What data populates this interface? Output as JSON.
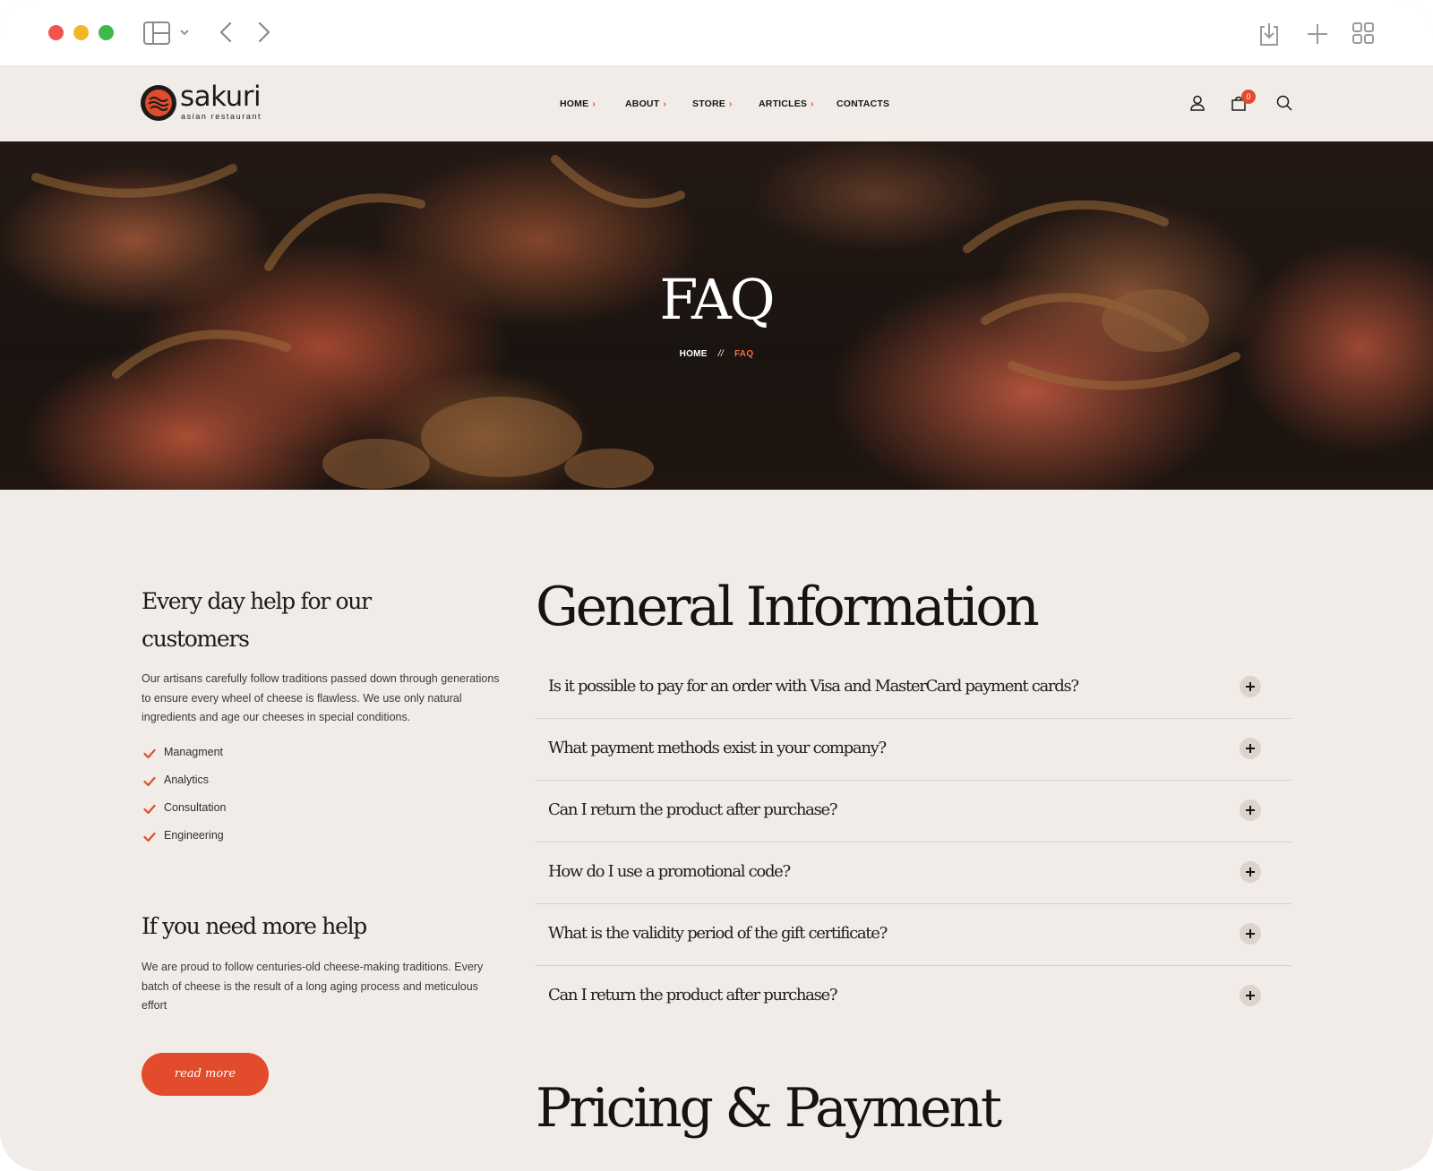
{
  "header": {
    "logo_name": "sakuri",
    "logo_tagline": "asian restaurant",
    "nav": [
      {
        "label": "HOME",
        "caret": "›"
      },
      {
        "label": "ABOUT",
        "caret": "›"
      },
      {
        "label": "STORE",
        "caret": "›"
      },
      {
        "label": "ARTICLES",
        "caret": "›"
      },
      {
        "label": "CONTACTS",
        "caret": ""
      }
    ],
    "cart_count": "0",
    "icons": [
      "user-icon",
      "cart-icon",
      "search-icon"
    ]
  },
  "hero": {
    "title": "FAQ",
    "breadcrumb": {
      "home": "HOME",
      "separator": "//",
      "current": "FAQ"
    }
  },
  "sidebar": {
    "heading_line1": "Every day help for our",
    "heading_line2": "customers",
    "text": "Our artisans carefully follow traditions passed down through generations to ensure every wheel of cheese is flawless. We use only natural ingredients and age our cheeses in special conditions.",
    "checklist": [
      "Managment",
      "Analytics",
      "Consultation",
      "Engineering"
    ],
    "help_heading": "If you need more help",
    "help_text": "We are proud to follow centuries-old cheese-making traditions. Every batch of cheese is the result of a long aging process and meticulous effort",
    "button_label": "read more"
  },
  "faq": {
    "title": "General Information",
    "questions": [
      "Is it possible to pay for an order with Visa and MasterCard payment cards?",
      "What payment methods exist in your company?",
      "Can I return the product after purchase?",
      "How do I use a promotional code?",
      "What is the validity period of the gift certificate?",
      "Can I return the product after purchase?"
    ]
  },
  "pricing": {
    "title": "Pricing & Payment"
  },
  "colors": {
    "accent": "#e24b2c",
    "background": "#f1ece8",
    "text": "#1b1b1b"
  }
}
